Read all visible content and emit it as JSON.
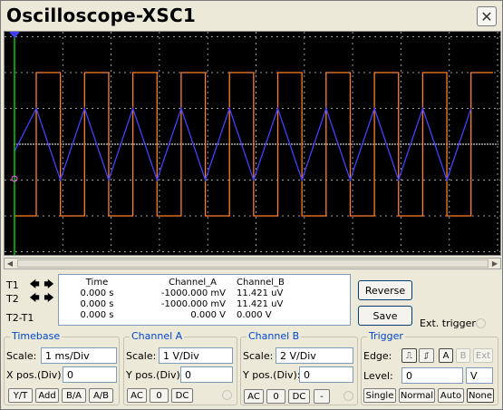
{
  "window": {
    "title": "Oscilloscope-XSC1",
    "close_symbol": "✕"
  },
  "colors": {
    "channel_a": "#4040ff",
    "channel_b": "#ff7f27",
    "center_line": "#ffffff",
    "grid": "#9a9a9a",
    "cursor_t1": "#ffffff",
    "cursor_t2": "#00cc00"
  },
  "waveforms": {
    "triangle_period_div": 1.0,
    "triangle_amplitude_div": 1.0,
    "square_period_div": 1.0,
    "square_amplitude_div": 4.0
  },
  "cursors": [
    {
      "label": "T1",
      "left_symbol": "🡄",
      "right_symbol": "🡆"
    },
    {
      "label": "T2",
      "left_symbol": "🡄",
      "right_symbol": "🡆"
    },
    {
      "label": "T2-T1"
    }
  ],
  "readout": {
    "headers": [
      "Time",
      "Channel_A",
      "Channel_B"
    ],
    "rows": [
      [
        "0.000 s",
        "-1000.000 mV",
        "11.421 uV"
      ],
      [
        "0.000 s",
        "-1000.000 mV",
        "11.421 uV"
      ],
      [
        "0.000 s",
        "0.000 V",
        "0.000 V"
      ]
    ]
  },
  "buttons": {
    "reverse": "Reverse",
    "save": "Save",
    "ext_trigger": "Ext. trigger"
  },
  "timebase": {
    "title": "Timebase",
    "scale_label": "Scale:",
    "scale_value": "1 ms/Div",
    "xpos_label": "X pos.(Div):",
    "xpos_value": "0",
    "modes": [
      "Y/T",
      "Add",
      "B/A",
      "A/B"
    ]
  },
  "channel_a": {
    "title": "Channel A",
    "scale_label": "Scale:",
    "scale_value": "1  V/Div",
    "ypos_label": "Y pos.(Div):",
    "ypos_value": "0",
    "coupling": [
      "AC",
      "0",
      "DC"
    ]
  },
  "channel_b": {
    "title": "Channel B",
    "scale_label": "Scale:",
    "scale_value": "2  V/Div",
    "ypos_label": "Y pos.(Div):",
    "ypos_value": "0",
    "coupling": [
      "AC",
      "0",
      "DC",
      "-"
    ]
  },
  "trigger": {
    "title": "Trigger",
    "edge_label": "Edge:",
    "edge_rising": "⎍",
    "edge_falling": "⎎",
    "sources": [
      "A",
      "B",
      "Ext"
    ],
    "level_label": "Level:",
    "level_value": "0",
    "level_unit": "V",
    "modes": [
      "Single",
      "Normal",
      "Auto",
      "None"
    ]
  }
}
